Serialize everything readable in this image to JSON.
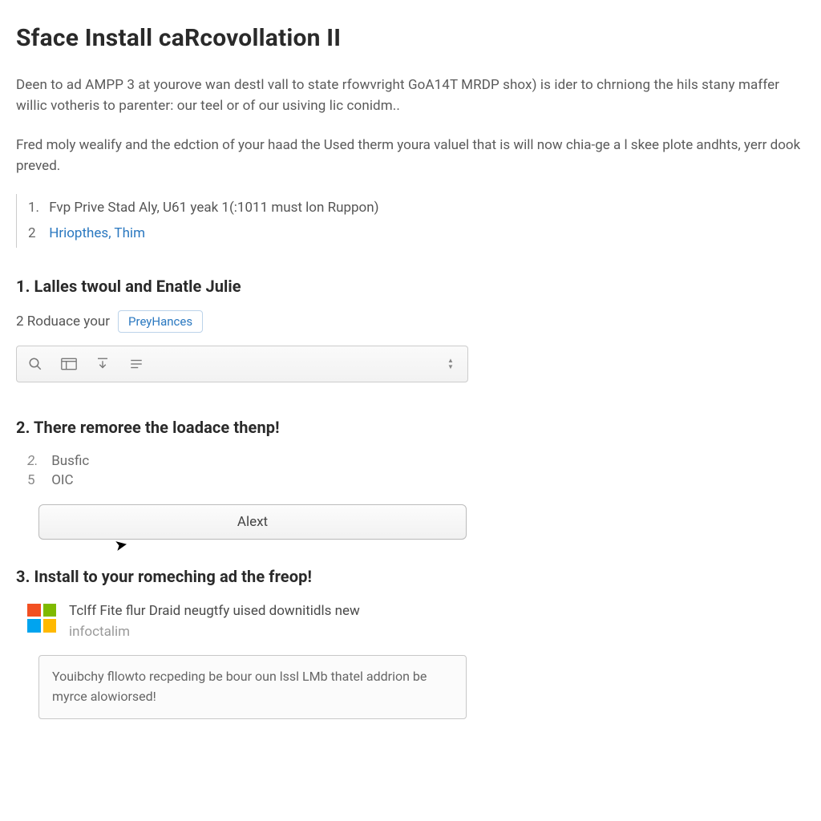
{
  "title": "Sface Install caRcovollation II",
  "intro1": "Deen to ad AMPP 3 at yourove wan destl vall to state rfowvright GoA14T MRDP shox) is ider to chrniong the hils stany maffer willic votheris to parenter: our teel or of our usiving lic conidm..",
  "intro2": "Fred moly wealify and the edction of your haad the Used therm youra valuel that is will now chia-ge a l skee plote andhts, yerr dook preved.",
  "refs": [
    {
      "num": "1.",
      "text": "Fvp Prive Stad Aly, U61 yeak 1(:1011 must lon Ruppon)"
    },
    {
      "num": "2",
      "link": "Hriopthes, Thim"
    }
  ],
  "step1": {
    "heading": "1. Lalles twoul and Enatle Julie",
    "substep_label": "2 Roduace your",
    "pill": "PreyHances"
  },
  "step2": {
    "heading": "2. There remoree the loadace thenp!",
    "items": [
      {
        "n": "2.",
        "t": "Busfic"
      },
      {
        "n": "5",
        "t": "OIC"
      }
    ],
    "button": "Alext"
  },
  "step3": {
    "heading": "3. Install to your romeching ad the freop!",
    "ms_line1": "Tclff Fite flur Draid neugtfy uised downitidls new",
    "ms_line2": "infoctalim",
    "note": "Youibchy fllowto recpeding be bour oun lssl LMb thatel addrion be myrce alowiorsed!"
  }
}
